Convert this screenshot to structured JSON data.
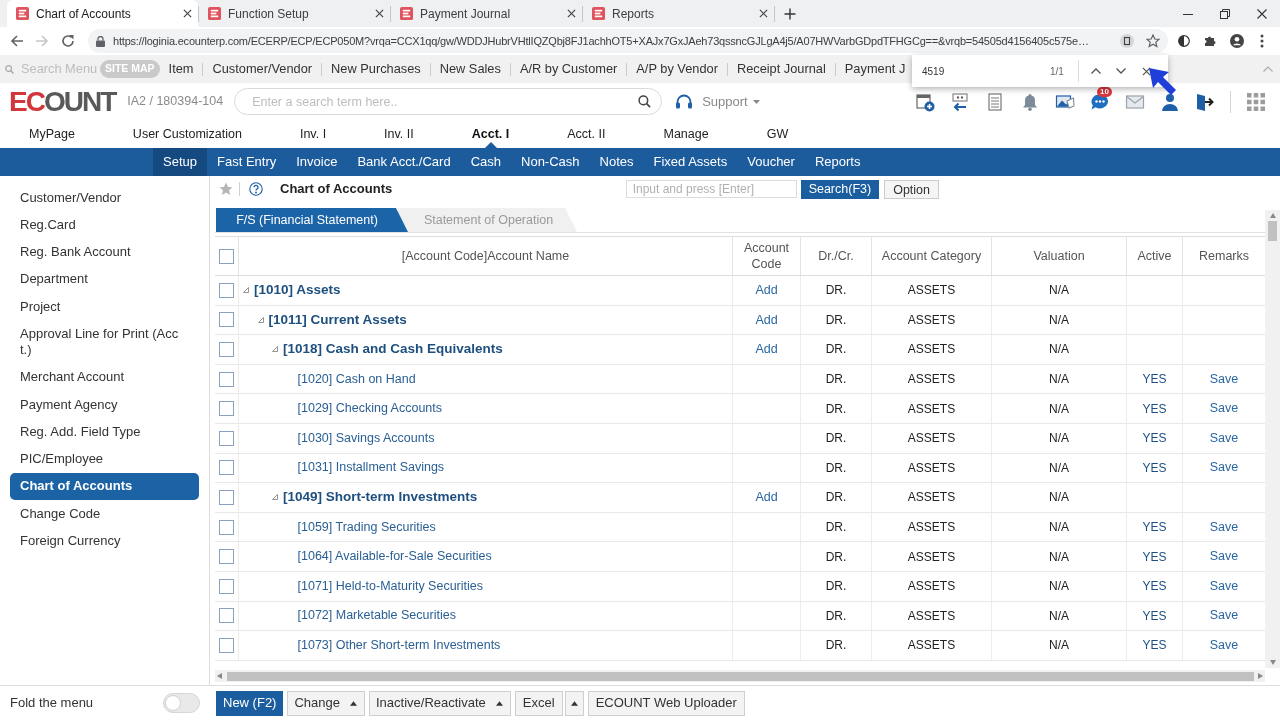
{
  "browser": {
    "tabs": [
      {
        "title": "Chart of Accounts",
        "selected": true
      },
      {
        "title": "Function Setup",
        "selected": false
      },
      {
        "title": "Payment Journal",
        "selected": false
      },
      {
        "title": "Reports",
        "selected": false
      }
    ],
    "url": "https://loginia.ecounterp.com/ECERP/ECP/ECP050M?vrqa=CCX1qq/gw/WDDJHubrVHtlIQZQbj8FJ1achhOT5+XAJx7GxJAeh73qssncGJLgA4j5/A07HWVarbGDpdTFHGCg==&vrqb=54505d4156405c575e…"
  },
  "find_bar": {
    "query": "4519",
    "count": "1/1"
  },
  "quick_menu": {
    "search_placeholder": "Search Menu",
    "site_map": "SITE MAP",
    "items": [
      "Item",
      "Customer/Vendor",
      "New Purchases",
      "New Sales",
      "A/R by Customer",
      "A/P by Vendor",
      "Receipt Journal",
      "Payment J"
    ]
  },
  "header": {
    "logo": "ECOUNT",
    "account": "IA2 / 180394-104",
    "search_placeholder": "Enter a search term here..",
    "support": "Support",
    "notification_count": "10"
  },
  "main_nav": [
    {
      "label": "MyPage",
      "selected": false
    },
    {
      "label": "User Customization",
      "selected": false
    },
    {
      "label": "Inv. I",
      "selected": false
    },
    {
      "label": "Inv. II",
      "selected": false
    },
    {
      "label": "Acct. I",
      "selected": true
    },
    {
      "label": "Acct. II",
      "selected": false
    },
    {
      "label": "Manage",
      "selected": false
    },
    {
      "label": "GW",
      "selected": false
    }
  ],
  "sub_nav": [
    {
      "label": "Setup",
      "selected": true
    },
    {
      "label": "Fast Entry",
      "selected": false
    },
    {
      "label": "Invoice",
      "selected": false
    },
    {
      "label": "Bank Acct./Card",
      "selected": false
    },
    {
      "label": "Cash",
      "selected": false
    },
    {
      "label": "Non-Cash",
      "selected": false
    },
    {
      "label": "Notes",
      "selected": false
    },
    {
      "label": "Fixed Assets",
      "selected": false
    },
    {
      "label": "Voucher",
      "selected": false
    },
    {
      "label": "Reports",
      "selected": false
    }
  ],
  "sidebar": {
    "items": [
      {
        "label": "Customer/Vendor",
        "selected": false
      },
      {
        "label": "Reg.Card",
        "selected": false
      },
      {
        "label": "Reg. Bank Account",
        "selected": false
      },
      {
        "label": "Department",
        "selected": false
      },
      {
        "label": "Project",
        "selected": false
      },
      {
        "label": "Approval Line for Print (Acct.)",
        "selected": false
      },
      {
        "label": "Merchant Account",
        "selected": false
      },
      {
        "label": "Payment Agency",
        "selected": false
      },
      {
        "label": "Reg. Add. Field Type",
        "selected": false
      },
      {
        "label": "PIC/Employee",
        "selected": false
      },
      {
        "label": "Chart of Accounts",
        "selected": true
      },
      {
        "label": "Change Code",
        "selected": false
      },
      {
        "label": "Foreign Currency",
        "selected": false
      }
    ],
    "fold_label": "Fold the menu",
    "fold_on": false
  },
  "page": {
    "title": "Chart of Accounts",
    "search_placeholder": "Input and press [Enter]",
    "search_button": "Search(F3)",
    "option_button": "Option"
  },
  "view_tabs": [
    {
      "label": "F/S (Financial Statement)",
      "selected": true
    },
    {
      "label": "Statement of Operation",
      "selected": false
    }
  ],
  "table": {
    "select_all_checked": false,
    "columns": [
      "[Account Code]Account Name",
      "Account Code",
      "Dr./Cr.",
      "Account Category",
      "Valuation",
      "Active",
      "Remarks"
    ],
    "rows": [
      {
        "name": "[1010] Assets",
        "kind": "group",
        "checked": false,
        "expanded": true,
        "account_code": "Add",
        "dr_cr": "DR.",
        "category": "ASSETS",
        "valuation": "N/A",
        "children": [
          {
            "name": "[1011] Current Assets",
            "kind": "group",
            "checked": false,
            "expanded": true,
            "account_code": "Add",
            "dr_cr": "DR.",
            "category": "ASSETS",
            "valuation": "N/A",
            "children": [
              {
                "name": "[1018] Cash and Cash Equivalents",
                "kind": "group",
                "checked": false,
                "expanded": true,
                "account_code": "Add",
                "dr_cr": "DR.",
                "category": "ASSETS",
                "valuation": "N/A",
                "children": [
                  {
                    "name": "[1020] Cash on Hand",
                    "kind": "account",
                    "checked": false,
                    "dr_cr": "DR.",
                    "category": "ASSETS",
                    "valuation": "N/A",
                    "active": "YES",
                    "remarks": "Save"
                  },
                  {
                    "name": "[1029] Checking Accounts",
                    "kind": "account",
                    "checked": false,
                    "dr_cr": "DR.",
                    "category": "ASSETS",
                    "valuation": "N/A",
                    "active": "YES",
                    "remarks": "Save"
                  },
                  {
                    "name": "[1030] Savings Accounts",
                    "kind": "account",
                    "checked": false,
                    "dr_cr": "DR.",
                    "category": "ASSETS",
                    "valuation": "N/A",
                    "active": "YES",
                    "remarks": "Save"
                  },
                  {
                    "name": "[1031] Installment Savings",
                    "kind": "account",
                    "checked": false,
                    "dr_cr": "DR.",
                    "category": "ASSETS",
                    "valuation": "N/A",
                    "active": "YES",
                    "remarks": "Save"
                  }
                ]
              },
              {
                "name": "[1049] Short-term Investments",
                "kind": "group",
                "checked": false,
                "expanded": true,
                "account_code": "Add",
                "dr_cr": "DR.",
                "category": "ASSETS",
                "valuation": "N/A",
                "children": [
                  {
                    "name": "[1059] Trading Securities",
                    "kind": "account",
                    "checked": false,
                    "dr_cr": "DR.",
                    "category": "ASSETS",
                    "valuation": "N/A",
                    "active": "YES",
                    "remarks": "Save"
                  },
                  {
                    "name": "[1064] Available-for-Sale Securities",
                    "kind": "account",
                    "checked": false,
                    "dr_cr": "DR.",
                    "category": "ASSETS",
                    "valuation": "N/A",
                    "active": "YES",
                    "remarks": "Save"
                  },
                  {
                    "name": "[1071] Held-to-Maturity Securities",
                    "kind": "account",
                    "checked": false,
                    "dr_cr": "DR.",
                    "category": "ASSETS",
                    "valuation": "N/A",
                    "active": "YES",
                    "remarks": "Save"
                  },
                  {
                    "name": "[1072] Marketable Securities",
                    "kind": "account",
                    "checked": false,
                    "dr_cr": "DR.",
                    "category": "ASSETS",
                    "valuation": "N/A",
                    "active": "YES",
                    "remarks": "Save"
                  },
                  {
                    "name": "[1073] Other Short-term Investments",
                    "kind": "account",
                    "checked": false,
                    "dr_cr": "DR.",
                    "category": "ASSETS",
                    "valuation": "N/A",
                    "active": "YES",
                    "remarks": "Save"
                  }
                ]
              }
            ]
          }
        ]
      }
    ]
  },
  "actions": [
    {
      "label": "New (F2)",
      "kind": "primary"
    },
    {
      "label": "Change",
      "kind": "dropdown"
    },
    {
      "label": "Inactive/Reactivate",
      "kind": "dropdown"
    },
    {
      "label": "Excel",
      "kind": "split"
    },
    {
      "label": "ECOUNT Web Uploader",
      "kind": "plain"
    }
  ]
}
